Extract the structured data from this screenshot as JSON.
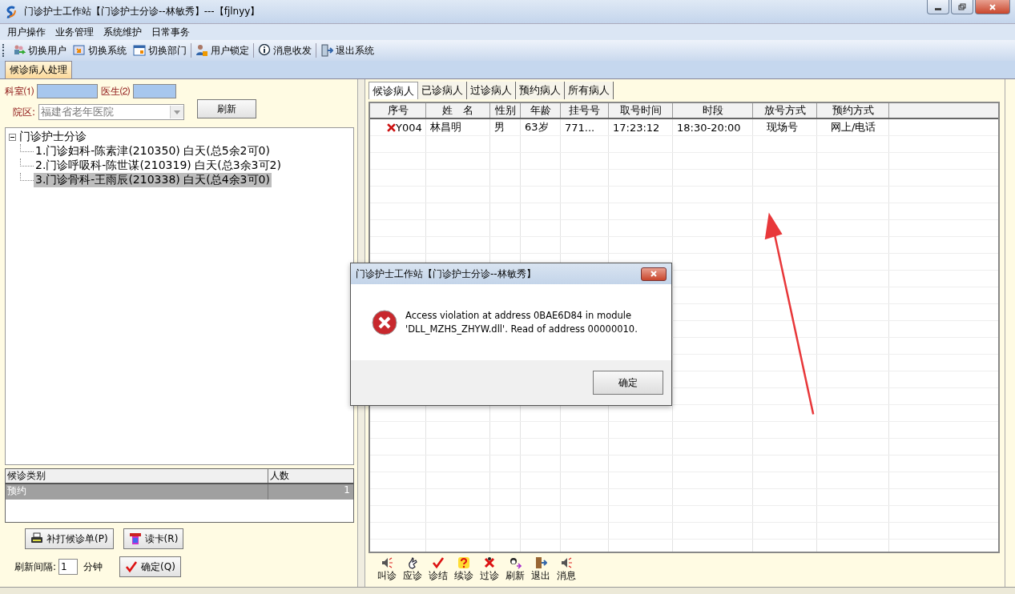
{
  "window": {
    "title": "门诊护士工作站【门诊护士分诊--林敏秀】---【fjlnyy】"
  },
  "menu": [
    "用户操作",
    "业务管理",
    "系统维护",
    "日常事务"
  ],
  "toolbar": [
    {
      "label": "切换用户"
    },
    {
      "label": "切换系统"
    },
    {
      "label": "切换部门"
    },
    {
      "label": "用户锁定"
    },
    {
      "label": "消息收发"
    },
    {
      "label": "退出系统"
    }
  ],
  "page_tabs": [
    {
      "label": "候诊病人处理",
      "selected": true
    }
  ],
  "filters": {
    "dept_label": "科室⑴",
    "doctor_label": "医生⑵",
    "campus_label": "院区:",
    "campus_value": "福建省老年医院",
    "refresh": "刷新"
  },
  "tree": {
    "label": "门诊护士分诊",
    "expanded": true,
    "children": [
      {
        "label": "1.门诊妇科-陈素津(210350) 白天(总5余2可0)",
        "selected": false
      },
      {
        "label": "2.门诊呼吸科-陈世谋(210319) 白天(总3余3可2)",
        "selected": false
      },
      {
        "label": "3.门诊骨科-王雨辰(210338) 白天(总4余3可0)",
        "selected": true
      }
    ]
  },
  "category_table": {
    "columns": [
      "候诊类别",
      "人数"
    ],
    "rows": [
      {
        "cells": [
          "预约",
          "1"
        ],
        "selected": true
      }
    ]
  },
  "left_buttons": [
    {
      "label": "补打候诊单(P)"
    },
    {
      "label": "读卡(R)"
    }
  ],
  "interval": {
    "label": "刷新间隔:",
    "value": "1",
    "unit": "分钟",
    "confirm": "确定(Q)"
  },
  "patient_tabs": [
    {
      "label": "候诊病人",
      "selected": true
    },
    {
      "label": "已诊病人",
      "selected": false
    },
    {
      "label": "过诊病人",
      "selected": false
    },
    {
      "label": "预约病人",
      "selected": false
    },
    {
      "label": "所有病人",
      "selected": false
    }
  ],
  "patient_table": {
    "columns": [
      "序号",
      "姓　名",
      "性别",
      "年龄",
      "挂号号",
      "取号时间",
      "时段",
      "放号方式",
      "预约方式"
    ],
    "rows": [
      {
        "cells": [
          "Y004",
          "林昌明",
          "男",
          "63岁",
          "771...",
          "17:23:12",
          "18:30-20:00",
          "现场号",
          "网上/电话"
        ]
      }
    ]
  },
  "actions": [
    {
      "label": "叫诊"
    },
    {
      "label": "应诊"
    },
    {
      "label": "诊结"
    },
    {
      "label": "续诊"
    },
    {
      "label": "过诊"
    },
    {
      "label": "刷新"
    },
    {
      "label": "退出"
    },
    {
      "label": "消息"
    }
  ],
  "dialog": {
    "title": "门诊护士工作站【门诊护士分诊--林敏秀】",
    "message": "Access violation at address 0BAE6D84 in module 'DLL_MZHS_ZHYW.dll'. Read of address 00000010.",
    "button": "确定"
  }
}
